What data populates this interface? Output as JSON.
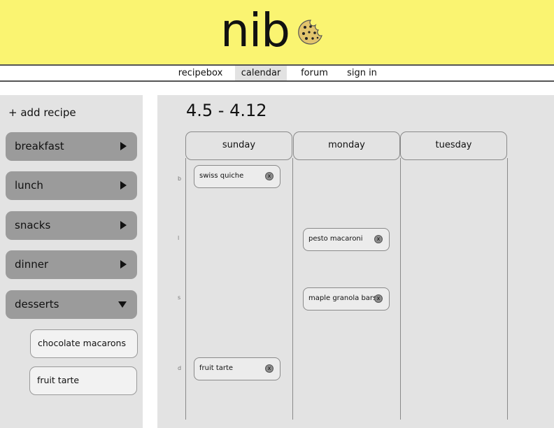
{
  "brand": {
    "name": "nib",
    "icon": "cookie-icon"
  },
  "nav": {
    "items": [
      {
        "label": "recipebox",
        "active": false
      },
      {
        "label": "calendar",
        "active": true
      },
      {
        "label": "forum",
        "active": false
      },
      {
        "label": "sign in",
        "active": false
      }
    ]
  },
  "sidebar": {
    "add_label": "+ add recipe",
    "categories": [
      {
        "label": "breakfast",
        "expanded": false
      },
      {
        "label": "lunch",
        "expanded": false
      },
      {
        "label": "snacks",
        "expanded": false
      },
      {
        "label": "dinner",
        "expanded": false
      },
      {
        "label": "desserts",
        "expanded": true
      }
    ],
    "dessert_items": [
      "chocolate macarons",
      "fruit tarte"
    ]
  },
  "calendar": {
    "range": "4.5 - 4.12",
    "days": [
      "sunday",
      "monday",
      "tuesday"
    ],
    "row_labels": [
      "b",
      "l",
      "s",
      "d"
    ],
    "entries": [
      {
        "day": "sunday",
        "row": "b",
        "label": "swiss quiche",
        "remove": "x"
      },
      {
        "day": "monday",
        "row": "l",
        "label": "pesto macaroni",
        "remove": "x"
      },
      {
        "day": "monday",
        "row": "s",
        "label": "maple granola bars",
        "remove": "x"
      },
      {
        "day": "sunday",
        "row": "d",
        "label": "fruit tarte",
        "remove": "x"
      }
    ]
  },
  "colors": {
    "header_bg": "#faf471",
    "panel_bg": "#e3e3e3",
    "category_bg": "#9b9b9b"
  }
}
